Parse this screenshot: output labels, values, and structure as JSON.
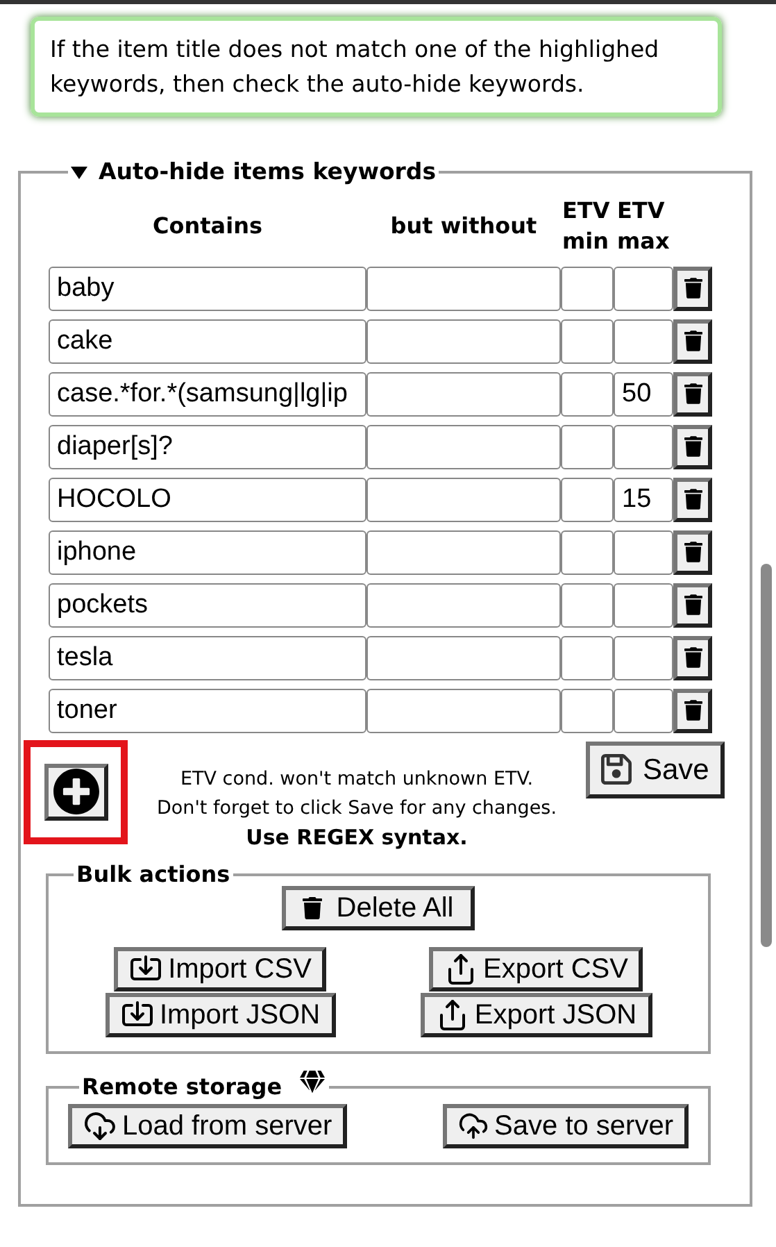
{
  "notice": "If the item title does not match one of the highlighed keywords, then check the auto-hide keywords.",
  "section": {
    "title": "Auto-hide items keywords",
    "expanded": true
  },
  "columns": [
    "Contains",
    "but without",
    "ETV min",
    "ETV max"
  ],
  "rows": [
    {
      "contains": "baby",
      "without": "",
      "etv_min": "",
      "etv_max": ""
    },
    {
      "contains": "cake",
      "without": "",
      "etv_min": "",
      "etv_max": ""
    },
    {
      "contains": "case.*for.*(samsung|lg|ip",
      "without": "",
      "etv_min": "",
      "etv_max": "50"
    },
    {
      "contains": "diaper[s]?",
      "without": "",
      "etv_min": "",
      "etv_max": ""
    },
    {
      "contains": "HOCOLO",
      "without": "",
      "etv_min": "",
      "etv_max": "15"
    },
    {
      "contains": "iphone",
      "without": "",
      "etv_min": "",
      "etv_max": ""
    },
    {
      "contains": "pockets",
      "without": "",
      "etv_min": "",
      "etv_max": ""
    },
    {
      "contains": "tesla",
      "without": "",
      "etv_min": "",
      "etv_max": ""
    },
    {
      "contains": "toner",
      "without": "",
      "etv_min": "",
      "etv_max": ""
    }
  ],
  "add_button": {
    "highlighted": true
  },
  "hints": [
    "ETV cond. won't match unknown ETV.",
    "Don't forget to click Save for any changes."
  ],
  "regex_note": "Use REGEX syntax.",
  "save_button": "Save",
  "bulk_actions": {
    "title": "Bulk actions",
    "delete_all": "Delete All",
    "buttons": [
      {
        "kind": "import",
        "label": "Import CSV"
      },
      {
        "kind": "export",
        "label": "Export CSV"
      },
      {
        "kind": "import",
        "label": "Import JSON"
      },
      {
        "kind": "export",
        "label": "Export JSON"
      }
    ]
  },
  "remote_storage": {
    "title": "Remote storage",
    "buttons": [
      {
        "kind": "load",
        "label": "Load from server"
      },
      {
        "kind": "save",
        "label": "Save to server"
      }
    ]
  }
}
